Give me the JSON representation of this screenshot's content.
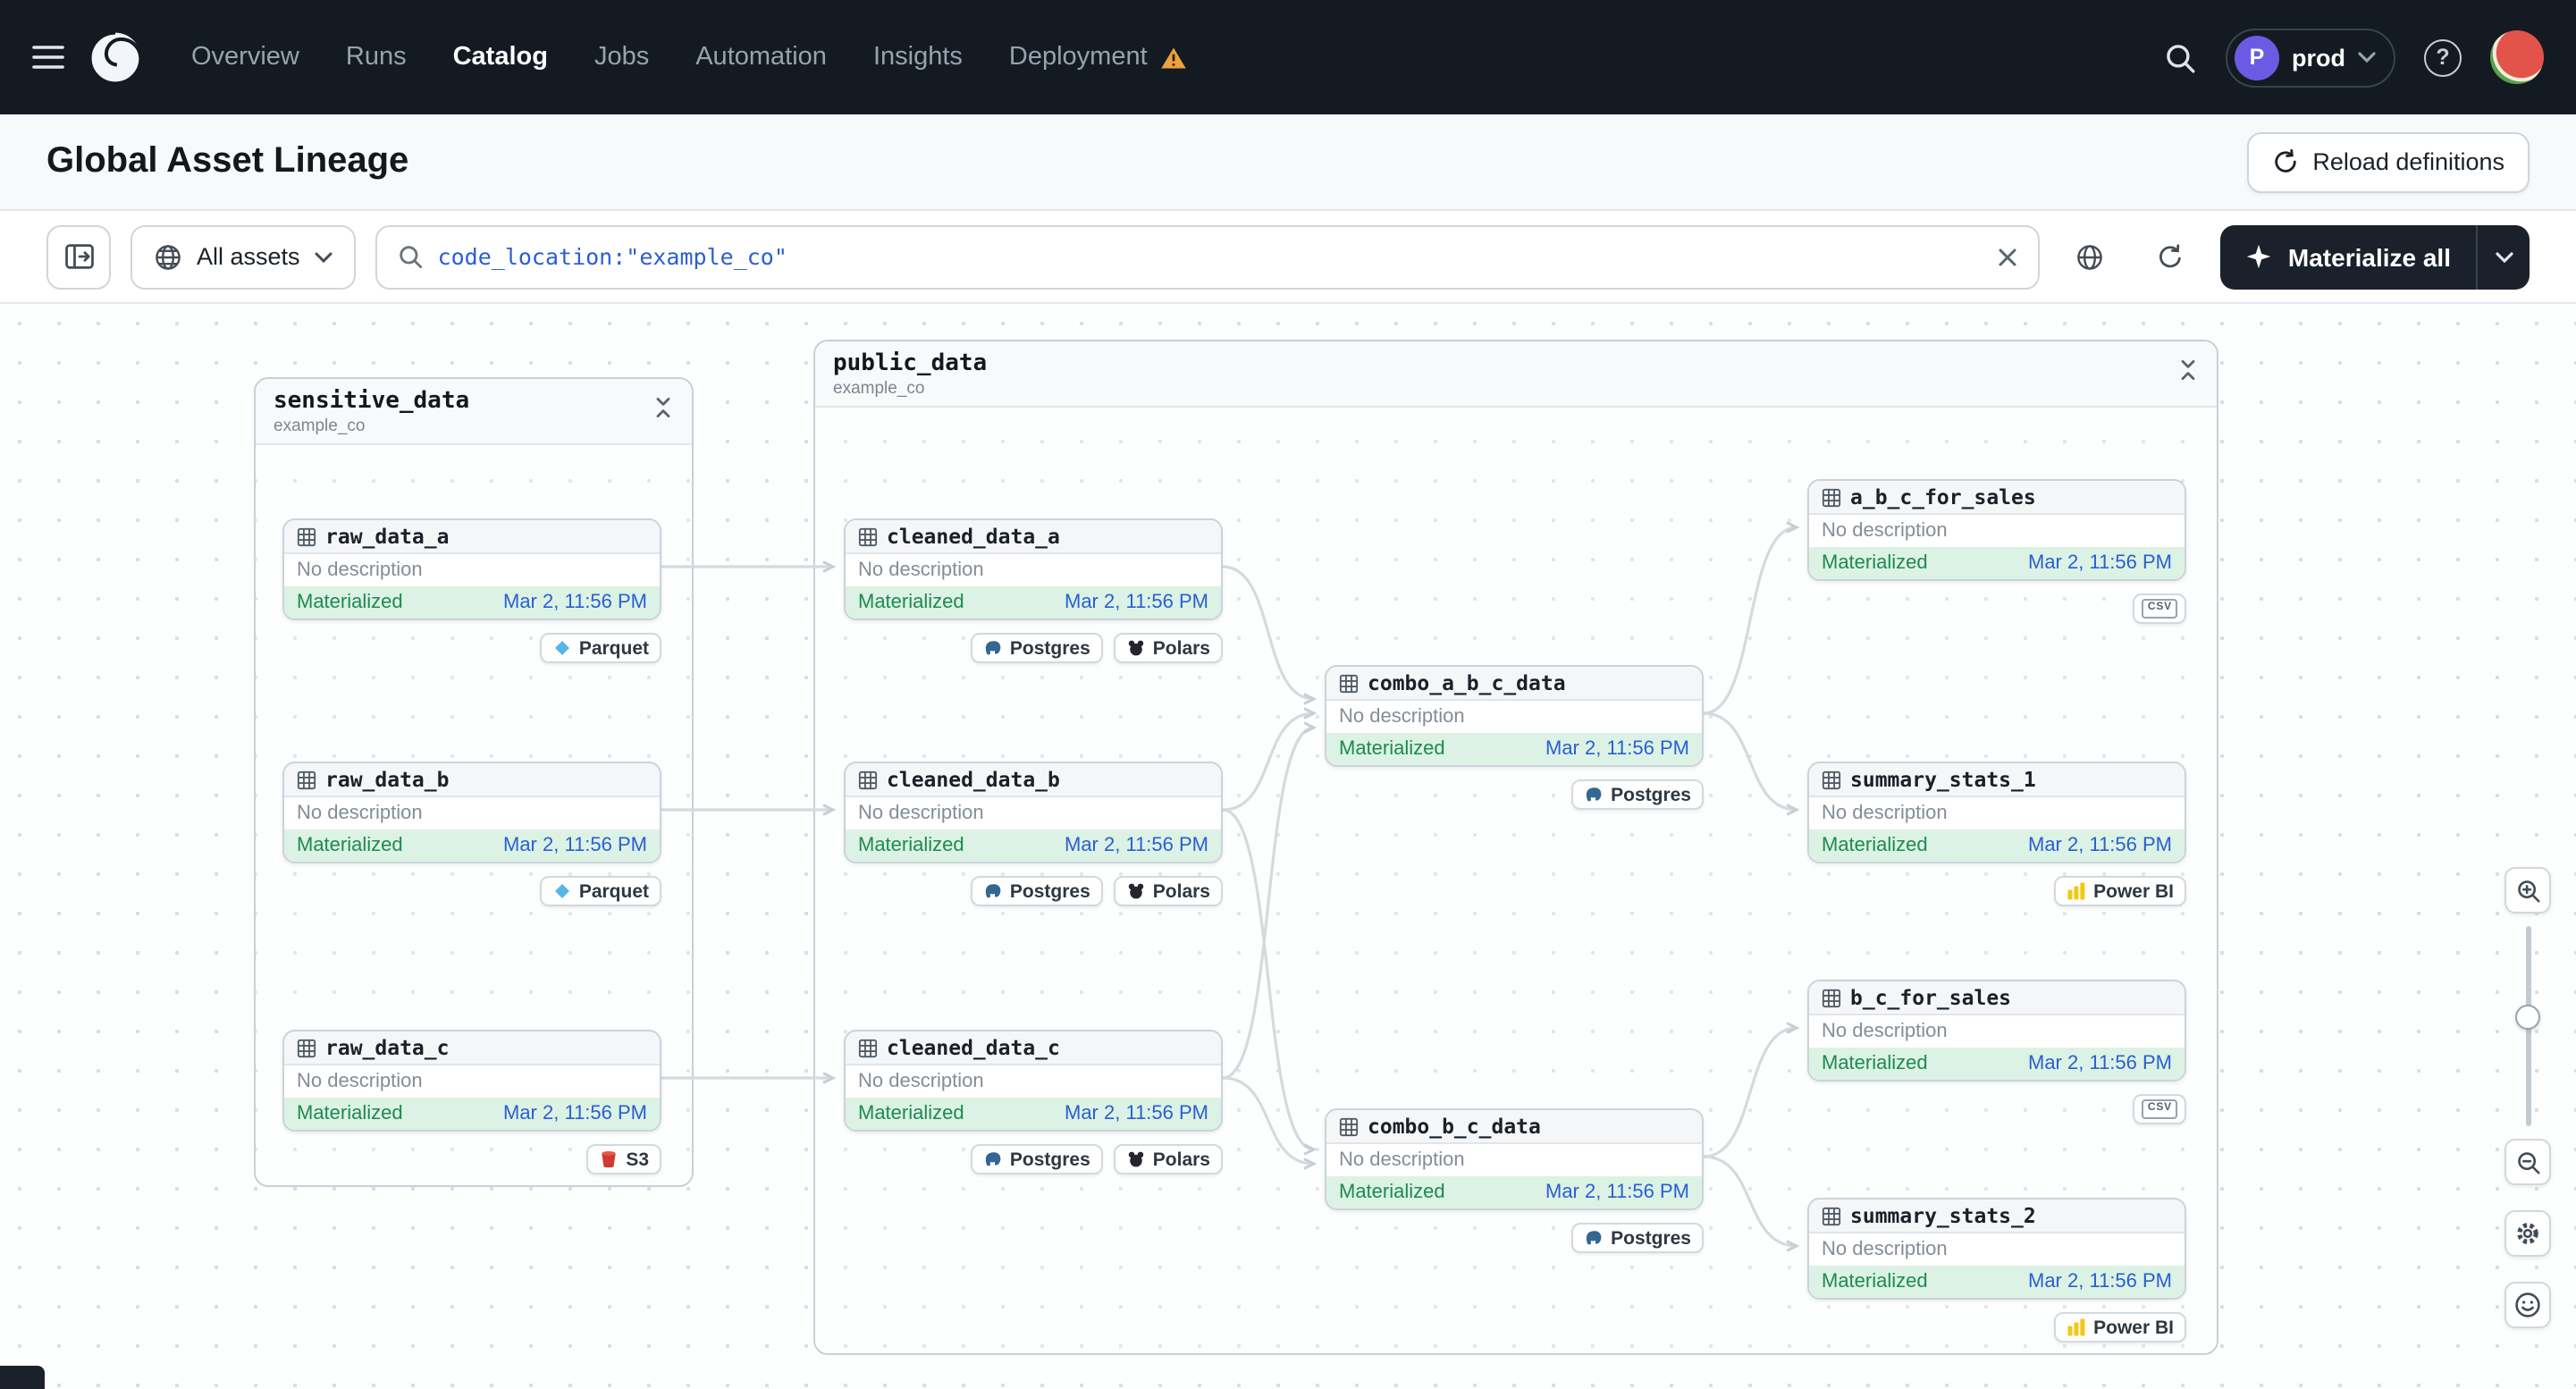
{
  "nav": {
    "items": [
      {
        "id": "overview",
        "label": "Overview",
        "active": false,
        "warning": false
      },
      {
        "id": "runs",
        "label": "Runs",
        "active": false,
        "warning": false
      },
      {
        "id": "catalog",
        "label": "Catalog",
        "active": true,
        "warning": false
      },
      {
        "id": "jobs",
        "label": "Jobs",
        "active": false,
        "warning": false
      },
      {
        "id": "automation",
        "label": "Automation",
        "active": false,
        "warning": false
      },
      {
        "id": "insights",
        "label": "Insights",
        "active": false,
        "warning": false
      },
      {
        "id": "deployment",
        "label": "Deployment",
        "active": false,
        "warning": true
      }
    ],
    "deployment": {
      "initial": "P",
      "name": "prod"
    },
    "help_label": "?"
  },
  "page": {
    "title": "Global Asset Lineage",
    "reload_button": "Reload definitions"
  },
  "toolbar": {
    "filter_button": "All assets",
    "search_value": "code_location:\"example_co\"",
    "materialize_button": "Materialize all"
  },
  "icons": {
    "csv_label": "CSV"
  },
  "graph": {
    "groups": [
      {
        "id": "sensitive_data",
        "title": "sensitive_data",
        "subtitle": "example_co"
      },
      {
        "id": "public_data",
        "title": "public_data",
        "subtitle": "example_co"
      }
    ],
    "nodes": [
      {
        "id": "raw_data_a",
        "label": "raw_data_a",
        "description": "No description",
        "status": "Materialized",
        "timestamp": "Mar 2, 11:56 PM",
        "tags": [
          {
            "icon": "parquet",
            "label": "Parquet"
          }
        ]
      },
      {
        "id": "raw_data_b",
        "label": "raw_data_b",
        "description": "No description",
        "status": "Materialized",
        "timestamp": "Mar 2, 11:56 PM",
        "tags": [
          {
            "icon": "parquet",
            "label": "Parquet"
          }
        ]
      },
      {
        "id": "raw_data_c",
        "label": "raw_data_c",
        "description": "No description",
        "status": "Materialized",
        "timestamp": "Mar 2, 11:56 PM",
        "tags": [
          {
            "icon": "s3",
            "label": "S3"
          }
        ]
      },
      {
        "id": "cleaned_data_a",
        "label": "cleaned_data_a",
        "description": "No description",
        "status": "Materialized",
        "timestamp": "Mar 2, 11:56 PM",
        "tags": [
          {
            "icon": "postgres",
            "label": "Postgres"
          },
          {
            "icon": "polars",
            "label": "Polars"
          }
        ]
      },
      {
        "id": "cleaned_data_b",
        "label": "cleaned_data_b",
        "description": "No description",
        "status": "Materialized",
        "timestamp": "Mar 2, 11:56 PM",
        "tags": [
          {
            "icon": "postgres",
            "label": "Postgres"
          },
          {
            "icon": "polars",
            "label": "Polars"
          }
        ]
      },
      {
        "id": "cleaned_data_c",
        "label": "cleaned_data_c",
        "description": "No description",
        "status": "Materialized",
        "timestamp": "Mar 2, 11:56 PM",
        "tags": [
          {
            "icon": "postgres",
            "label": "Postgres"
          },
          {
            "icon": "polars",
            "label": "Polars"
          }
        ]
      },
      {
        "id": "combo_a_b_c_data",
        "label": "combo_a_b_c_data",
        "description": "No description",
        "status": "Materialized",
        "timestamp": "Mar 2, 11:56 PM",
        "tags": [
          {
            "icon": "postgres",
            "label": "Postgres"
          }
        ]
      },
      {
        "id": "combo_b_c_data",
        "label": "combo_b_c_data",
        "description": "No description",
        "status": "Materialized",
        "timestamp": "Mar 2, 11:56 PM",
        "tags": [
          {
            "icon": "postgres",
            "label": "Postgres"
          }
        ]
      },
      {
        "id": "a_b_c_for_sales",
        "label": "a_b_c_for_sales",
        "description": "No description",
        "status": "Materialized",
        "timestamp": "Mar 2, 11:56 PM",
        "tags": [
          {
            "icon": "csv",
            "label": ""
          }
        ]
      },
      {
        "id": "summary_stats_1",
        "label": "summary_stats_1",
        "description": "No description",
        "status": "Materialized",
        "timestamp": "Mar 2, 11:56 PM",
        "tags": [
          {
            "icon": "powerbi",
            "label": "Power BI"
          }
        ]
      },
      {
        "id": "b_c_for_sales",
        "label": "b_c_for_sales",
        "description": "No description",
        "status": "Materialized",
        "timestamp": "Mar 2, 11:56 PM",
        "tags": [
          {
            "icon": "csv",
            "label": ""
          }
        ]
      },
      {
        "id": "summary_stats_2",
        "label": "summary_stats_2",
        "description": "No description",
        "status": "Materialized",
        "timestamp": "Mar 2, 11:56 PM",
        "tags": [
          {
            "icon": "powerbi",
            "label": "Power BI"
          }
        ]
      }
    ],
    "edges": [
      [
        "raw_data_a",
        "cleaned_data_a"
      ],
      [
        "raw_data_b",
        "cleaned_data_b"
      ],
      [
        "raw_data_c",
        "cleaned_data_c"
      ],
      [
        "cleaned_data_a",
        "combo_a_b_c_data"
      ],
      [
        "cleaned_data_b",
        "combo_a_b_c_data"
      ],
      [
        "cleaned_data_c",
        "combo_a_b_c_data"
      ],
      [
        "cleaned_data_b",
        "combo_b_c_data"
      ],
      [
        "cleaned_data_c",
        "combo_b_c_data"
      ],
      [
        "combo_a_b_c_data",
        "a_b_c_for_sales"
      ],
      [
        "combo_a_b_c_data",
        "summary_stats_1"
      ],
      [
        "combo_b_c_data",
        "b_c_for_sales"
      ],
      [
        "combo_b_c_data",
        "summary_stats_2"
      ]
    ]
  }
}
